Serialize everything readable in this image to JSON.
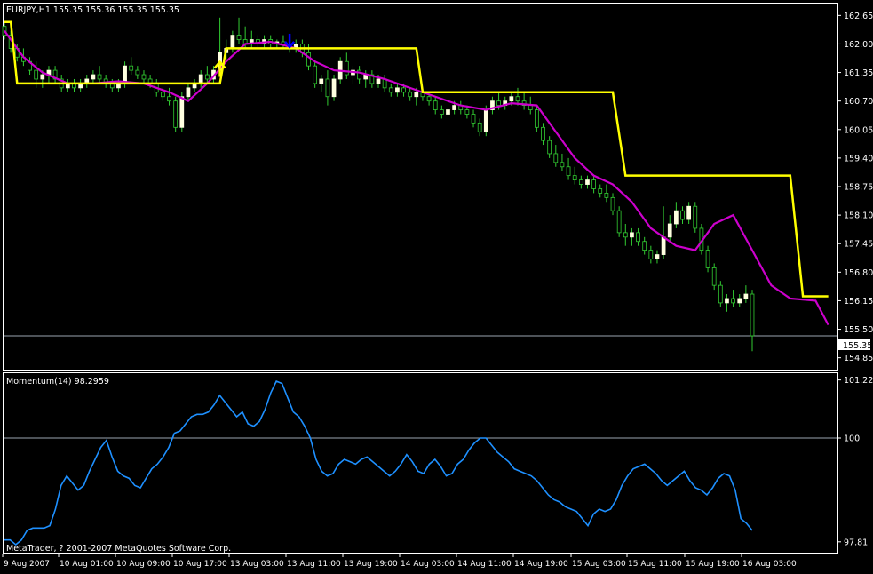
{
  "header": {
    "symbol_line": "EURJPY,H1  155.35 155.36 155.35 155.35"
  },
  "indicator_label": "Momentum(14) 98.2959",
  "footer_copyright": "MetaTrader, ? 2001-2007 MetaQuotes Software Corp.",
  "current_price_label": "155.35",
  "colors": {
    "background": "#000000",
    "frame": "#ffffff",
    "bull_candle": "#ffffe0",
    "wick": "#32cd32",
    "signal_line": "#ffff00",
    "ma_line": "#cc00cc",
    "momentum_line": "#1e90ff",
    "buy_arrow": "#ffff00",
    "sell_arrow": "#0000ff"
  },
  "chart_data": [
    {
      "type": "candlestick",
      "title": "EURJPY,H1",
      "ohlc_text": "155.35 155.36 155.35 155.35",
      "ylim": [
        154.6,
        162.9
      ],
      "y_ticks": [
        "162.65",
        "162.00",
        "161.35",
        "160.70",
        "160.05",
        "159.40",
        "158.75",
        "158.10",
        "157.45",
        "156.80",
        "156.15",
        "155.50",
        "154.85"
      ],
      "x_tick_labels": [
        "9 Aug 2007",
        "10 Aug 01:00",
        "10 Aug 09:00",
        "10 Aug 17:00",
        "13 Aug 03:00",
        "13 Aug 11:00",
        "13 Aug 19:00",
        "14 Aug 03:00",
        "14 Aug 11:00",
        "14 Aug 19:00",
        "15 Aug 03:00",
        "15 Aug 11:00",
        "15 Aug 19:00",
        "16 Aug 03:00"
      ],
      "current_price": 155.35,
      "candles": [
        [
          162.4,
          162.5,
          162.1,
          162.2
        ],
        [
          162.2,
          162.3,
          161.8,
          161.9
        ],
        [
          161.9,
          162.0,
          161.6,
          161.7
        ],
        [
          161.7,
          161.9,
          161.5,
          161.6
        ],
        [
          161.6,
          161.7,
          161.3,
          161.4
        ],
        [
          161.4,
          161.6,
          161.0,
          161.2
        ],
        [
          161.2,
          161.4,
          161.0,
          161.3
        ],
        [
          161.3,
          161.5,
          161.1,
          161.4
        ],
        [
          161.4,
          161.5,
          161.1,
          161.2
        ],
        [
          161.2,
          161.3,
          160.9,
          161.0
        ],
        [
          161.0,
          161.2,
          160.9,
          161.1
        ],
        [
          161.1,
          161.2,
          160.9,
          161.0
        ],
        [
          161.0,
          161.2,
          160.9,
          161.1
        ],
        [
          161.1,
          161.3,
          161.0,
          161.2
        ],
        [
          161.2,
          161.4,
          161.1,
          161.3
        ],
        [
          161.3,
          161.5,
          161.1,
          161.2
        ],
        [
          161.2,
          161.3,
          161.0,
          161.1
        ],
        [
          161.1,
          161.2,
          160.9,
          161.0
        ],
        [
          161.0,
          161.2,
          160.9,
          161.1
        ],
        [
          161.1,
          161.6,
          161.0,
          161.5
        ],
        [
          161.5,
          161.7,
          161.3,
          161.4
        ],
        [
          161.4,
          161.5,
          161.2,
          161.3
        ],
        [
          161.3,
          161.4,
          161.1,
          161.2
        ],
        [
          161.2,
          161.3,
          161.0,
          161.1
        ],
        [
          161.1,
          161.2,
          160.8,
          160.9
        ],
        [
          160.9,
          161.0,
          160.7,
          160.8
        ],
        [
          160.8,
          161.0,
          160.6,
          160.7
        ],
        [
          160.7,
          160.8,
          160.0,
          160.1
        ],
        [
          160.1,
          160.9,
          160.0,
          160.8
        ],
        [
          160.8,
          161.1,
          160.7,
          161.0
        ],
        [
          161.0,
          161.2,
          160.9,
          161.1
        ],
        [
          161.1,
          161.4,
          161.0,
          161.3
        ],
        [
          161.3,
          161.5,
          161.1,
          161.2
        ],
        [
          161.2,
          161.5,
          161.1,
          161.4
        ],
        [
          161.4,
          162.6,
          161.3,
          161.8
        ],
        [
          161.8,
          162.1,
          161.6,
          161.9
        ],
        [
          161.9,
          162.3,
          161.8,
          162.2
        ],
        [
          162.2,
          162.6,
          162.0,
          162.1
        ],
        [
          162.1,
          162.4,
          161.9,
          162.0
        ],
        [
          162.0,
          162.3,
          161.9,
          162.1
        ],
        [
          162.1,
          162.2,
          161.9,
          162.0
        ],
        [
          162.0,
          162.2,
          161.9,
          162.1
        ],
        [
          162.1,
          162.2,
          161.9,
          162.0
        ],
        [
          162.0,
          162.1,
          161.9,
          162.05
        ],
        [
          162.05,
          162.2,
          161.9,
          162.0
        ],
        [
          162.0,
          162.1,
          161.8,
          161.9
        ],
        [
          161.9,
          162.1,
          161.8,
          162.0
        ],
        [
          162.0,
          162.1,
          161.7,
          161.8
        ],
        [
          161.8,
          162.0,
          161.4,
          161.5
        ],
        [
          161.5,
          161.6,
          161.0,
          161.1
        ],
        [
          161.1,
          161.3,
          160.9,
          161.2
        ],
        [
          161.2,
          161.4,
          160.6,
          160.8
        ],
        [
          160.8,
          161.3,
          160.7,
          161.2
        ],
        [
          161.2,
          161.7,
          161.1,
          161.6
        ],
        [
          161.6,
          161.8,
          161.2,
          161.3
        ],
        [
          161.3,
          161.5,
          161.1,
          161.4
        ],
        [
          161.4,
          161.5,
          161.1,
          161.2
        ],
        [
          161.2,
          161.4,
          161.0,
          161.3
        ],
        [
          161.3,
          161.4,
          161.0,
          161.1
        ],
        [
          161.1,
          161.3,
          161.0,
          161.2
        ],
        [
          161.2,
          161.3,
          160.9,
          161.0
        ],
        [
          161.0,
          161.1,
          160.8,
          160.9
        ],
        [
          160.9,
          161.1,
          160.8,
          161.0
        ],
        [
          161.0,
          161.1,
          160.8,
          160.9
        ],
        [
          160.9,
          161.0,
          160.7,
          160.8
        ],
        [
          160.8,
          161.0,
          160.6,
          160.9
        ],
        [
          160.9,
          161.0,
          160.7,
          160.8
        ],
        [
          160.8,
          160.9,
          160.6,
          160.7
        ],
        [
          160.7,
          160.8,
          160.4,
          160.5
        ],
        [
          160.5,
          160.6,
          160.3,
          160.4
        ],
        [
          160.4,
          160.6,
          160.3,
          160.5
        ],
        [
          160.5,
          160.7,
          160.4,
          160.6
        ],
        [
          160.6,
          160.7,
          160.4,
          160.5
        ],
        [
          160.5,
          160.6,
          160.3,
          160.4
        ],
        [
          160.4,
          160.5,
          160.1,
          160.2
        ],
        [
          160.2,
          160.3,
          159.9,
          160.0
        ],
        [
          160.0,
          160.6,
          159.9,
          160.5
        ],
        [
          160.5,
          160.8,
          160.4,
          160.7
        ],
        [
          160.7,
          160.9,
          160.5,
          160.6
        ],
        [
          160.6,
          160.8,
          160.5,
          160.7
        ],
        [
          160.7,
          160.9,
          160.6,
          160.8
        ],
        [
          160.8,
          161.0,
          160.6,
          160.7
        ],
        [
          160.7,
          160.9,
          160.5,
          160.6
        ],
        [
          160.6,
          160.8,
          160.4,
          160.5
        ],
        [
          160.5,
          160.6,
          160.0,
          160.1
        ],
        [
          160.1,
          160.2,
          159.7,
          159.8
        ],
        [
          159.8,
          159.9,
          159.4,
          159.5
        ],
        [
          159.5,
          159.7,
          159.2,
          159.3
        ],
        [
          159.3,
          159.5,
          159.1,
          159.2
        ],
        [
          159.2,
          159.4,
          158.9,
          159.0
        ],
        [
          159.0,
          159.2,
          158.8,
          158.9
        ],
        [
          158.9,
          159.0,
          158.7,
          158.8
        ],
        [
          158.8,
          159.0,
          158.7,
          158.9
        ],
        [
          158.9,
          159.0,
          158.6,
          158.7
        ],
        [
          158.7,
          158.8,
          158.5,
          158.6
        ],
        [
          158.6,
          158.8,
          158.4,
          158.5
        ],
        [
          158.5,
          158.6,
          158.1,
          158.2
        ],
        [
          158.2,
          158.3,
          157.6,
          157.7
        ],
        [
          157.7,
          157.9,
          157.4,
          157.6
        ],
        [
          157.6,
          157.8,
          157.4,
          157.7
        ],
        [
          157.7,
          157.8,
          157.4,
          157.5
        ],
        [
          157.5,
          157.6,
          157.2,
          157.3
        ],
        [
          157.3,
          157.4,
          157.0,
          157.1
        ],
        [
          157.1,
          157.3,
          157.0,
          157.2
        ],
        [
          157.2,
          158.3,
          157.1,
          157.6
        ],
        [
          157.6,
          158.1,
          157.5,
          157.9
        ],
        [
          157.9,
          158.4,
          157.8,
          158.2
        ],
        [
          158.2,
          158.3,
          157.9,
          158.0
        ],
        [
          158.0,
          158.4,
          157.9,
          158.3
        ],
        [
          158.3,
          158.4,
          157.7,
          157.8
        ],
        [
          157.8,
          157.9,
          157.2,
          157.3
        ],
        [
          157.3,
          157.4,
          156.8,
          156.9
        ],
        [
          156.9,
          157.0,
          156.4,
          156.5
        ],
        [
          156.5,
          156.6,
          156.0,
          156.1
        ],
        [
          156.1,
          156.3,
          155.9,
          156.2
        ],
        [
          156.2,
          156.4,
          156.0,
          156.1
        ],
        [
          156.1,
          156.3,
          156.0,
          156.2
        ],
        [
          156.2,
          156.5,
          156.1,
          156.3
        ],
        [
          156.3,
          156.4,
          155.0,
          155.35
        ]
      ],
      "signal_line": [
        [
          0,
          162.5
        ],
        [
          1,
          162.5
        ],
        [
          2,
          161.1
        ],
        [
          17,
          161.1
        ],
        [
          24,
          161.1
        ],
        [
          34,
          161.1
        ],
        [
          35,
          161.9
        ],
        [
          46,
          161.9
        ],
        [
          54,
          161.9
        ],
        [
          65,
          161.9
        ],
        [
          66,
          160.9
        ],
        [
          96,
          160.9
        ],
        [
          98,
          159.0
        ],
        [
          124,
          159.0
        ],
        [
          126,
          156.25
        ],
        [
          130,
          156.25
        ]
      ],
      "moving_average": [
        [
          0,
          162.3
        ],
        [
          3,
          161.7
        ],
        [
          6,
          161.35
        ],
        [
          10,
          161.1
        ],
        [
          14,
          161.1
        ],
        [
          18,
          161.15
        ],
        [
          22,
          161.1
        ],
        [
          26,
          160.9
        ],
        [
          29,
          160.7
        ],
        [
          32,
          161.1
        ],
        [
          35,
          161.6
        ],
        [
          38,
          162.0
        ],
        [
          42,
          162.05
        ],
        [
          46,
          161.9
        ],
        [
          49,
          161.6
        ],
        [
          52,
          161.4
        ],
        [
          56,
          161.35
        ],
        [
          60,
          161.2
        ],
        [
          64,
          161.0
        ],
        [
          68,
          160.8
        ],
        [
          72,
          160.6
        ],
        [
          76,
          160.5
        ],
        [
          80,
          160.65
        ],
        [
          84,
          160.6
        ],
        [
          87,
          160.0
        ],
        [
          90,
          159.4
        ],
        [
          93,
          159.0
        ],
        [
          96,
          158.8
        ],
        [
          99,
          158.4
        ],
        [
          102,
          157.8
        ],
        [
          106,
          157.4
        ],
        [
          109,
          157.3
        ],
        [
          112,
          157.9
        ],
        [
          115,
          158.1
        ],
        [
          118,
          157.3
        ],
        [
          121,
          156.5
        ],
        [
          124,
          156.2
        ],
        [
          128,
          156.15
        ],
        [
          130,
          155.6
        ]
      ],
      "arrows": [
        {
          "type": "buy",
          "bar": 34,
          "price": 161.25
        },
        {
          "type": "sell",
          "bar": 45,
          "price": 161.95
        }
      ]
    },
    {
      "type": "line",
      "title": "Momentum(14) 98.2959",
      "ylim": [
        97.6,
        101.35
      ],
      "y_ticks": [
        "101.2257",
        "100",
        "97.81"
      ],
      "reference_level": 100,
      "series": [
        {
          "values": [
            97.85,
            97.85,
            97.75,
            97.85,
            98.05,
            98.1,
            98.1,
            98.1,
            98.15,
            98.5,
            99.0,
            99.2,
            99.05,
            98.9,
            99.0,
            99.3,
            99.55,
            99.8,
            99.95,
            99.6,
            99.3,
            99.2,
            99.15,
            99.0,
            98.95,
            99.15,
            99.35,
            99.45,
            99.6,
            99.8,
            100.1,
            100.15,
            100.3,
            100.45,
            100.5,
            100.5,
            100.55,
            100.7,
            100.9,
            100.75,
            100.6,
            100.45,
            100.55,
            100.3,
            100.25,
            100.35,
            100.6,
            100.95,
            101.2,
            101.15,
            100.85,
            100.55,
            100.45,
            100.25,
            100.0,
            99.55,
            99.3,
            99.2,
            99.25,
            99.45,
            99.55,
            99.5,
            99.45,
            99.55,
            99.6,
            99.5,
            99.4,
            99.3,
            99.2,
            99.3,
            99.45,
            99.65,
            99.5,
            99.3,
            99.25,
            99.45,
            99.55,
            99.4,
            99.2,
            99.25,
            99.45,
            99.55,
            99.75,
            99.9,
            100.0,
            100.0,
            99.85,
            99.7,
            99.6,
            99.5,
            99.35,
            99.3,
            99.25,
            99.2,
            99.1,
            98.95,
            98.8,
            98.7,
            98.65,
            98.55,
            98.5,
            98.45,
            98.3,
            98.15,
            98.4,
            98.5,
            98.45,
            98.5,
            98.7,
            99.0,
            99.2,
            99.35,
            99.4,
            99.45,
            99.35,
            99.25,
            99.1,
            99.0,
            99.1,
            99.2,
            99.3,
            99.1,
            98.95,
            98.9,
            98.8,
            98.95,
            99.15,
            99.25,
            99.2,
            98.9,
            98.3,
            98.2,
            98.05
          ]
        }
      ]
    }
  ]
}
